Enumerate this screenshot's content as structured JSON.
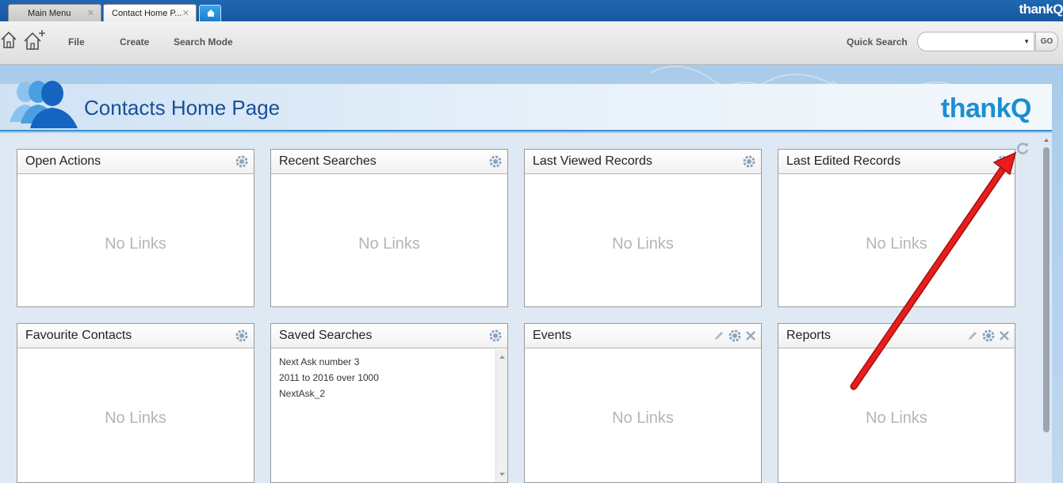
{
  "tabs": [
    {
      "label": "Main Menu"
    },
    {
      "label": "Contact Home P..."
    }
  ],
  "brand": {
    "text": "thankQ"
  },
  "toolbar": {
    "menu": [
      "File",
      "Create",
      "Search Mode"
    ],
    "quick_search_label": "Quick Search",
    "quick_search_value": "",
    "go_label": "GO"
  },
  "page": {
    "title": "Contacts Home Page"
  },
  "panels": [
    {
      "title": "Open Actions",
      "empty": "No Links",
      "items": []
    },
    {
      "title": "Recent Searches",
      "empty": "No Links",
      "items": []
    },
    {
      "title": "Last Viewed Records",
      "empty": "No Links",
      "items": []
    },
    {
      "title": "Last Edited Records",
      "empty": "No Links",
      "items": []
    },
    {
      "title": "Favourite Contacts",
      "empty": "No Links",
      "items": []
    },
    {
      "title": "Saved Searches",
      "empty": "",
      "items": [
        "Next Ask number 3",
        "2011 to 2016 over 1000",
        "NextAsk_2"
      ]
    },
    {
      "title": "Events",
      "empty": "No Links",
      "items": []
    },
    {
      "title": "Reports",
      "empty": "No Links",
      "items": []
    }
  ],
  "colors": {
    "tab_bar": "#1f67b3",
    "title": "#1a4f95",
    "brand": "#1a8fd0",
    "annotation_arrow": "#e81d1d"
  }
}
